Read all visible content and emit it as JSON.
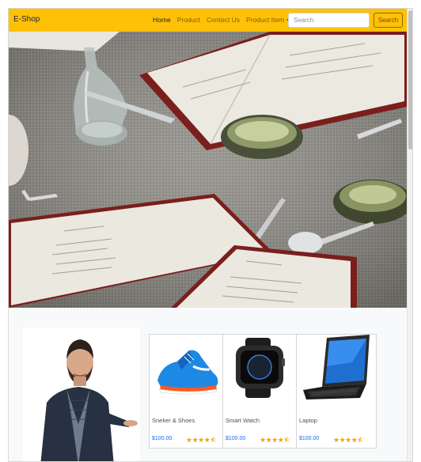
{
  "navbar": {
    "brand": "E-Shop",
    "links": [
      "Home",
      "Product",
      "Contect Us",
      "Product Item"
    ],
    "search_placeholder": "Search",
    "search_button": "Search"
  },
  "products": [
    {
      "title": "Sneker & Shoes",
      "price": "$100.00",
      "rating": 4.5
    },
    {
      "title": "Smart Watch",
      "price": "$100.00",
      "rating": 4.5
    },
    {
      "title": "Laptop",
      "price": "$100.00",
      "rating": 4.5
    }
  ],
  "colors": {
    "navbar": "#ffc107",
    "price": "#0d6efd",
    "star": "#f0a500"
  },
  "icons": {
    "dropdown": "caret-down-icon",
    "star": "star-icon",
    "half_star": "half-star-icon"
  }
}
